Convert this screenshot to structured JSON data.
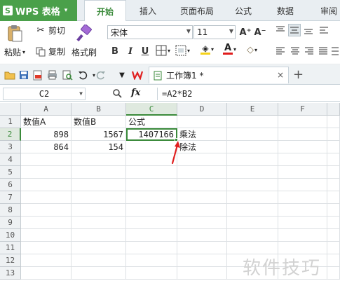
{
  "app": {
    "logo_glyph": "S",
    "name": "WPS 表格",
    "brand_color": "#4aa04a"
  },
  "ribbon_tabs": [
    "开始",
    "插入",
    "页面布局",
    "公式",
    "数据",
    "审阅"
  ],
  "ribbon": {
    "paste_label": "粘贴",
    "cut_label": "剪切",
    "copy_label": "复制",
    "format_painter_label": "格式刷",
    "font_name": "宋体",
    "font_size": "11",
    "bold": "B",
    "italic": "I",
    "underline": "U",
    "grow_font": "A⁺",
    "shrink_font": "A⁻",
    "font_color_glyph": "A",
    "font_color_bar": "#e01c1c",
    "fill_color_bar": "#f5d21a"
  },
  "doc_tab": {
    "title": "工作簿1 *",
    "close": "×",
    "new_tab": "+"
  },
  "formula_bar": {
    "cell_ref": "C2",
    "fx": "fx",
    "formula": "=A2*B2"
  },
  "sheet": {
    "columns": [
      "A",
      "B",
      "C",
      "D",
      "E",
      "F"
    ],
    "rows": [
      "1",
      "2",
      "3",
      "4",
      "5",
      "6",
      "7",
      "8",
      "9",
      "10",
      "11",
      "12",
      "13"
    ],
    "cells": {
      "A1": "数值A",
      "B1": "数值B",
      "C1": "公式",
      "A2": "898",
      "B2": "1567",
      "C2": "1407166",
      "D2": "乘法",
      "A3": "864",
      "B3": "154",
      "D3": "除法"
    },
    "active_cell": "C2",
    "accent_color": "#3a8a3a"
  },
  "watermark": "软件技巧",
  "annotation_color": "#e02020"
}
